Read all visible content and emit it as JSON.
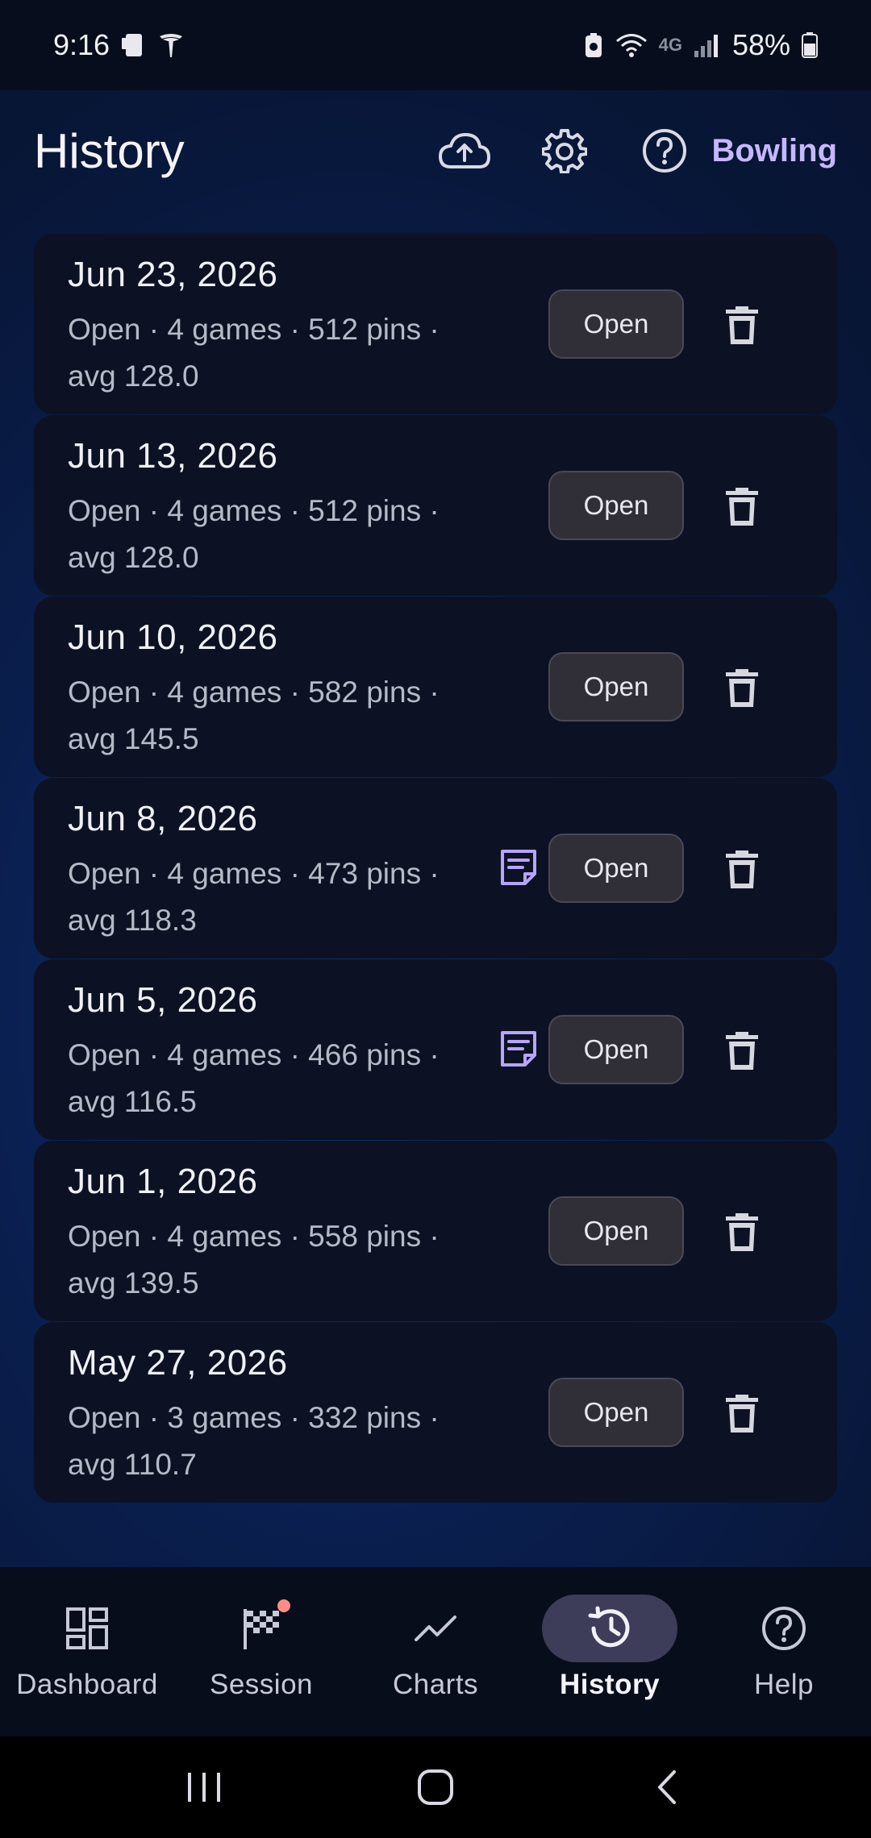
{
  "status_bar": {
    "time": "9:16",
    "network": "4G",
    "battery": "58%"
  },
  "app_bar": {
    "title": "History",
    "bowling_link": "Bowling",
    "icons": [
      "cloud-upload-icon",
      "gear-icon",
      "help-icon"
    ]
  },
  "sessions": [
    {
      "date": "Jun 23, 2026",
      "summary": "Open · 4 games · 512 pins · avg 128.0",
      "has_note": false,
      "open_label": "Open"
    },
    {
      "date": "Jun 13, 2026",
      "summary": "Open · 4 games · 512 pins · avg 128.0",
      "has_note": false,
      "open_label": "Open"
    },
    {
      "date": "Jun 10, 2026",
      "summary": "Open · 4 games · 582 pins · avg 145.5",
      "has_note": false,
      "open_label": "Open"
    },
    {
      "date": "Jun 8, 2026",
      "summary": "Open · 4 games · 473 pins · avg 118.3",
      "has_note": true,
      "open_label": "Open"
    },
    {
      "date": "Jun 5, 2026",
      "summary": "Open · 4 games · 466 pins · avg 116.5",
      "has_note": true,
      "open_label": "Open"
    },
    {
      "date": "Jun 1, 2026",
      "summary": "Open · 4 games · 558 pins · avg 139.5",
      "has_note": false,
      "open_label": "Open"
    },
    {
      "date": "May 27, 2026",
      "summary": "Open · 3 games · 332 pins · avg 110.7",
      "has_note": false,
      "open_label": "Open"
    }
  ],
  "bottom_nav": {
    "active": "History",
    "items": [
      {
        "label": "Dashboard",
        "icon": "dashboard-icon"
      },
      {
        "label": "Session",
        "icon": "checkered-flag-icon",
        "badge": true
      },
      {
        "label": "Charts",
        "icon": "trend-line-icon"
      },
      {
        "label": "History",
        "icon": "history-icon"
      },
      {
        "label": "Help",
        "icon": "help-icon"
      }
    ]
  },
  "colors": {
    "accent": "#c6b8ff",
    "card": "#0c1224",
    "nav_indicator": "#3d3c59",
    "badge": "#ff8d85"
  }
}
